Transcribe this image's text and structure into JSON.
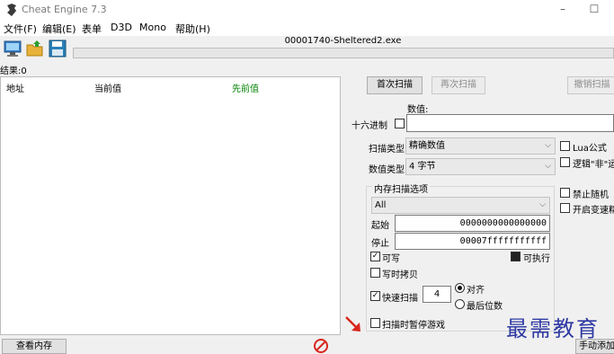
{
  "window": {
    "title": "Cheat Engine 7.3",
    "minimize": "–",
    "maximize": "☐"
  },
  "menu": [
    "文件(F)",
    "编辑(E)",
    "表单",
    "D3D",
    "Mono",
    "帮助(H)"
  ],
  "toolbar": {
    "process_name": "00001740-Sheltered2.exe"
  },
  "results": {
    "found_label": "结果:0"
  },
  "list": {
    "columns": [
      "地址",
      "当前值",
      "先前值"
    ],
    "prev_color": "#008000"
  },
  "scan": {
    "first_scan": "首次扫描",
    "next_scan": "再次扫描",
    "undo_scan": "撤销扫描",
    "value_label": "数值:",
    "hex_label": "十六进制",
    "value_input": "",
    "scan_type_label": "扫描类型",
    "scan_type_value": "精确数值",
    "value_type_label": "数值类型",
    "value_type_value": "4 字节",
    "lua_formula": "Lua公式",
    "not_logic": "逻辑\"非\"运",
    "disable_random": "禁止随机",
    "speedhack": "开启变速精"
  },
  "mem": {
    "title": "内存扫描选项",
    "region": "All",
    "start_label": "起始",
    "start_value": "0000000000000000",
    "stop_label": "停止",
    "stop_value": "00007fffffffffff",
    "writable": "可写",
    "executable": "可执行",
    "copy_on_write": "写时拷贝",
    "fast_scan": "快速扫描",
    "fast_scan_value": "4",
    "align": "对齐",
    "last_digits": "最后位数",
    "pause_game": "扫描时暂停游戏"
  },
  "bottom": {
    "view_memory": "查看内存",
    "add_manual": "手动添加"
  },
  "watermark": "最需教育"
}
